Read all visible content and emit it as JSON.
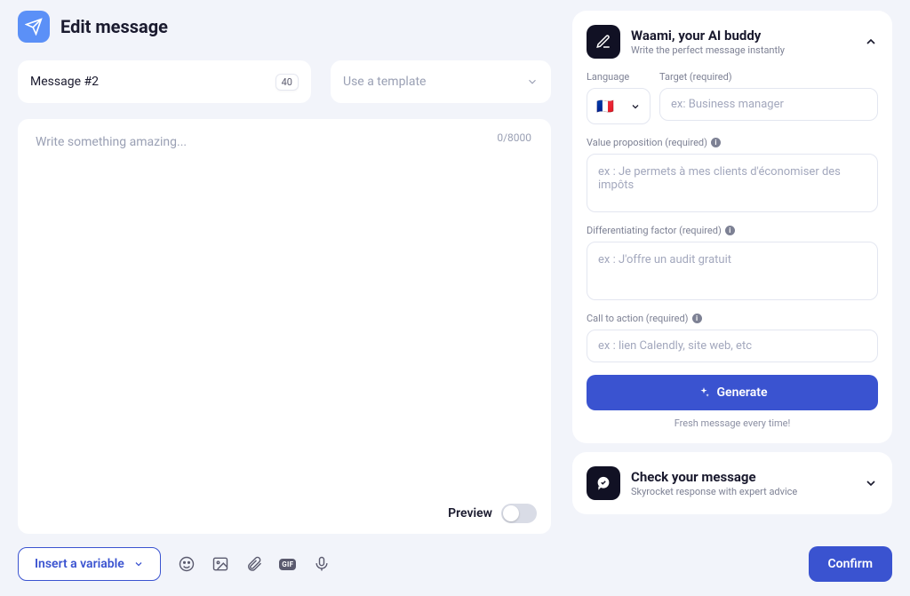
{
  "header": {
    "title": "Edit message"
  },
  "message_name": {
    "value": "Message #2",
    "char_limit": "40"
  },
  "template": {
    "placeholder": "Use a template"
  },
  "editor": {
    "placeholder": "Write something amazing...",
    "counter": "0/8000"
  },
  "ai_panel": {
    "title": "Waami, your AI buddy",
    "subtitle": "Write the perfect message instantly",
    "language_label": "Language",
    "language_flag": "🇫🇷",
    "target_label": "Target (required)",
    "target_placeholder": "ex: Business manager",
    "value_prop_label": "Value proposition (required)",
    "value_prop_placeholder": "ex : Je permets à mes clients d'économiser des impôts",
    "diff_label": "Differentiating factor (required)",
    "diff_placeholder": "ex : J'offre un audit gratuit",
    "cta_label": "Call to action (required)",
    "cta_placeholder": "ex : lien Calendly, site web, etc",
    "generate_label": "Generate",
    "fresh_note": "Fresh message every time!"
  },
  "check_panel": {
    "title": "Check your message",
    "subtitle": "Skyrocket response with expert advice"
  },
  "preview": {
    "label": "Preview"
  },
  "insert_variable_label": "Insert a variable",
  "confirm_label": "Confirm"
}
